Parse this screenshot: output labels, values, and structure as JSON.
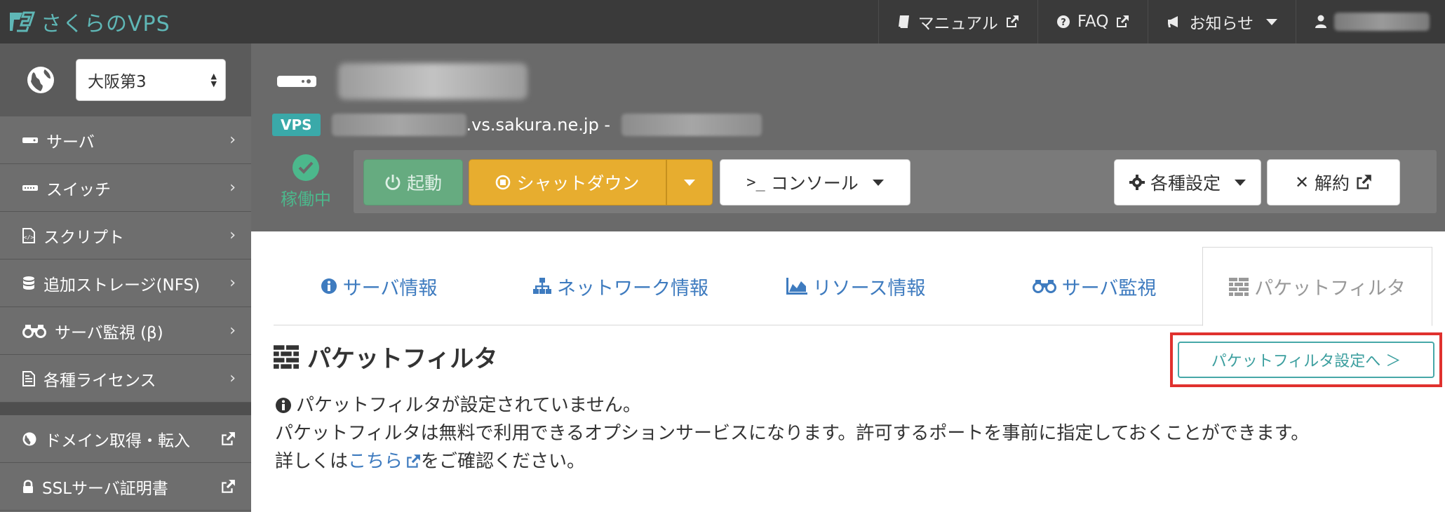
{
  "app": {
    "logo_text": "さくらのVPS",
    "brand_color": "#5fb7b6"
  },
  "topnav": {
    "manual": "マニュアル",
    "faq": "FAQ",
    "news": "お知らせ"
  },
  "sidebar": {
    "region": "大阪第3",
    "items": [
      {
        "label": "サーバ",
        "icon": "server-icon"
      },
      {
        "label": "スイッチ",
        "icon": "switch-icon"
      },
      {
        "label": "スクリプト",
        "icon": "script-icon"
      },
      {
        "label": "追加ストレージ(NFS)",
        "icon": "database-icon"
      },
      {
        "label": "サーバ監視 (β)",
        "icon": "binoculars-icon"
      },
      {
        "label": "各種ライセンス",
        "icon": "document-icon"
      }
    ],
    "external_items": [
      {
        "label": "ドメイン取得・転入",
        "icon": "globe-icon"
      },
      {
        "label": "SSLサーバ証明書",
        "icon": "lock-icon"
      }
    ]
  },
  "server": {
    "badge": "VPS",
    "host_suffix": ".vs.sakura.ne.jp -",
    "status": "稼働中",
    "status_color": "#4cb88c"
  },
  "actions": {
    "start": "起動",
    "shutdown": "シャットダウン",
    "console": "コンソール",
    "settings": "各種設定",
    "cancel": "解約"
  },
  "tabs": [
    {
      "label": "サーバ情報",
      "icon": "info-icon"
    },
    {
      "label": "ネットワーク情報",
      "icon": "sitemap-icon"
    },
    {
      "label": "リソース情報",
      "icon": "area-chart-icon"
    },
    {
      "label": "サーバ監視",
      "icon": "binoculars-icon"
    },
    {
      "label": "パケットフィルタ",
      "icon": "firewall-icon",
      "active": true
    }
  ],
  "content": {
    "title": "パケットフィルタ",
    "settings_button": "パケットフィルタ設定へ ＞",
    "notice": "パケットフィルタが設定されていません。",
    "description": "パケットフィルタは無料で利用できるオプションサービスになります。許可するポートを事前に指定しておくことができます。",
    "detail_prefix": "詳しくは",
    "detail_link": "こちら",
    "detail_suffix": "をご確認ください。",
    "link_color": "#3e7bbf"
  }
}
